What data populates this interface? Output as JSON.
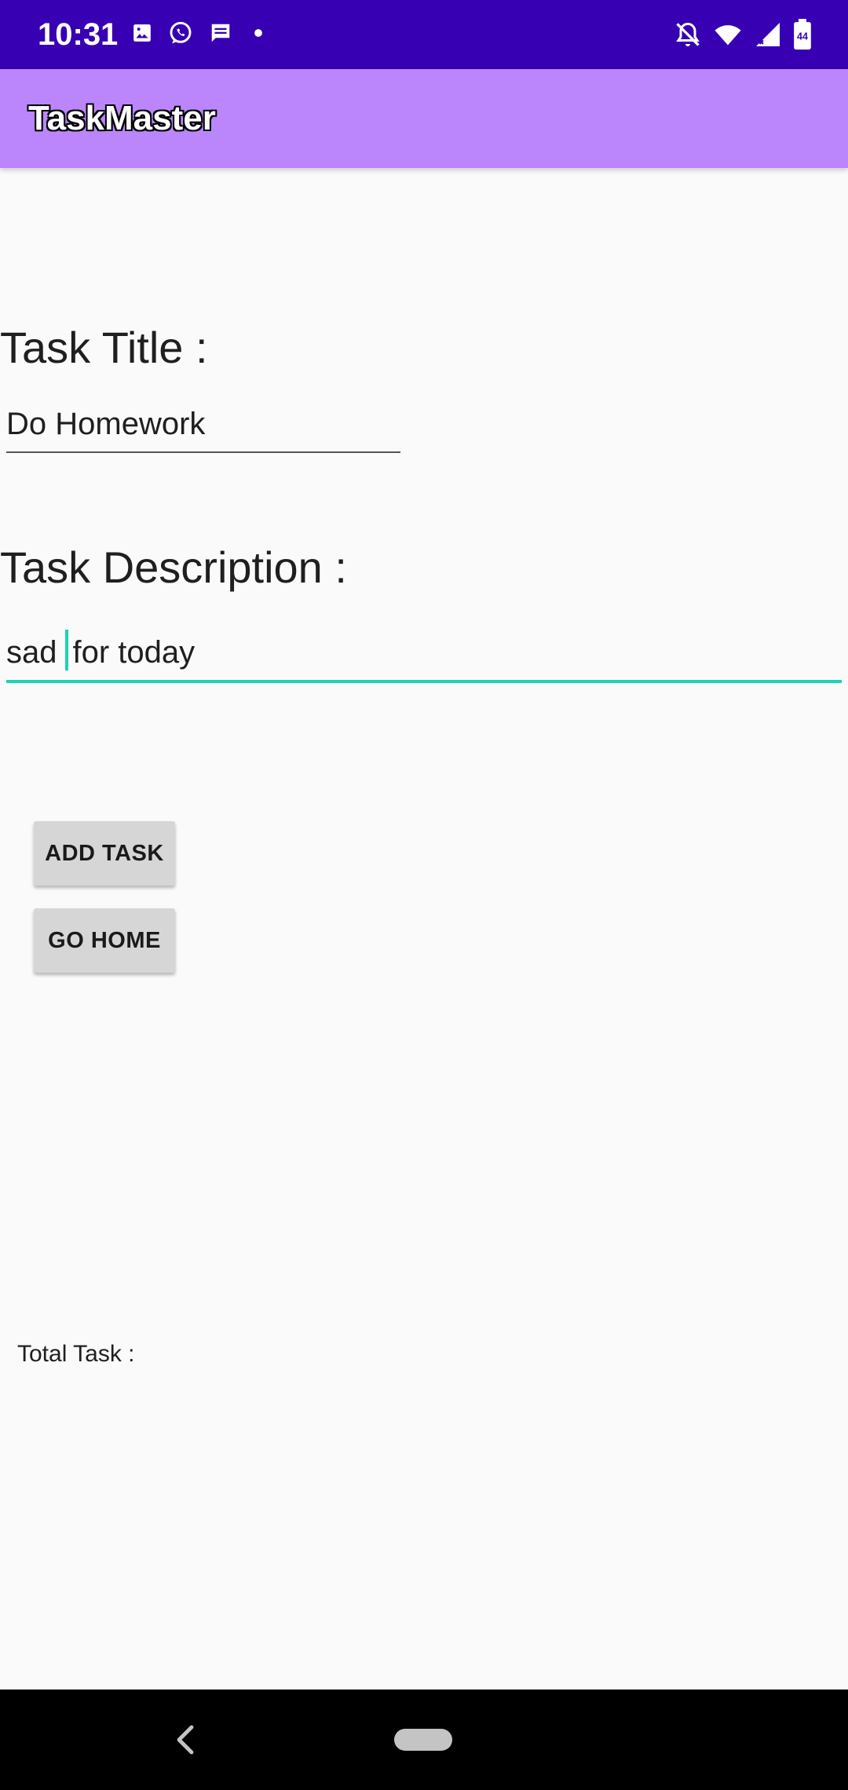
{
  "status_bar": {
    "time": "10:31",
    "left_icons": [
      "image-icon",
      "whatsapp-icon",
      "message-icon",
      "dot-icon"
    ],
    "right_icons": [
      "notifications-off-icon",
      "wifi-icon",
      "signal-icon",
      "battery-icon"
    ],
    "battery_level": "44",
    "colors": {
      "background": "#3700b3"
    }
  },
  "app_bar": {
    "title": "TaskMaster",
    "colors": {
      "background": "#bb86fc"
    }
  },
  "form": {
    "title_label": "Task Title :",
    "title_value": "Do Homework",
    "description_label": "Task Description :",
    "description_value_before_cursor": "sad",
    "description_value_after_cursor": "for today",
    "focus_color": "#1ad3b5"
  },
  "actions": {
    "add_task_label": "ADD TASK",
    "go_home_label": "GO HOME"
  },
  "footer": {
    "total_task_label": "Total Task :"
  },
  "nav_bar": {
    "icons": [
      "back-icon",
      "home-pill-icon"
    ]
  }
}
